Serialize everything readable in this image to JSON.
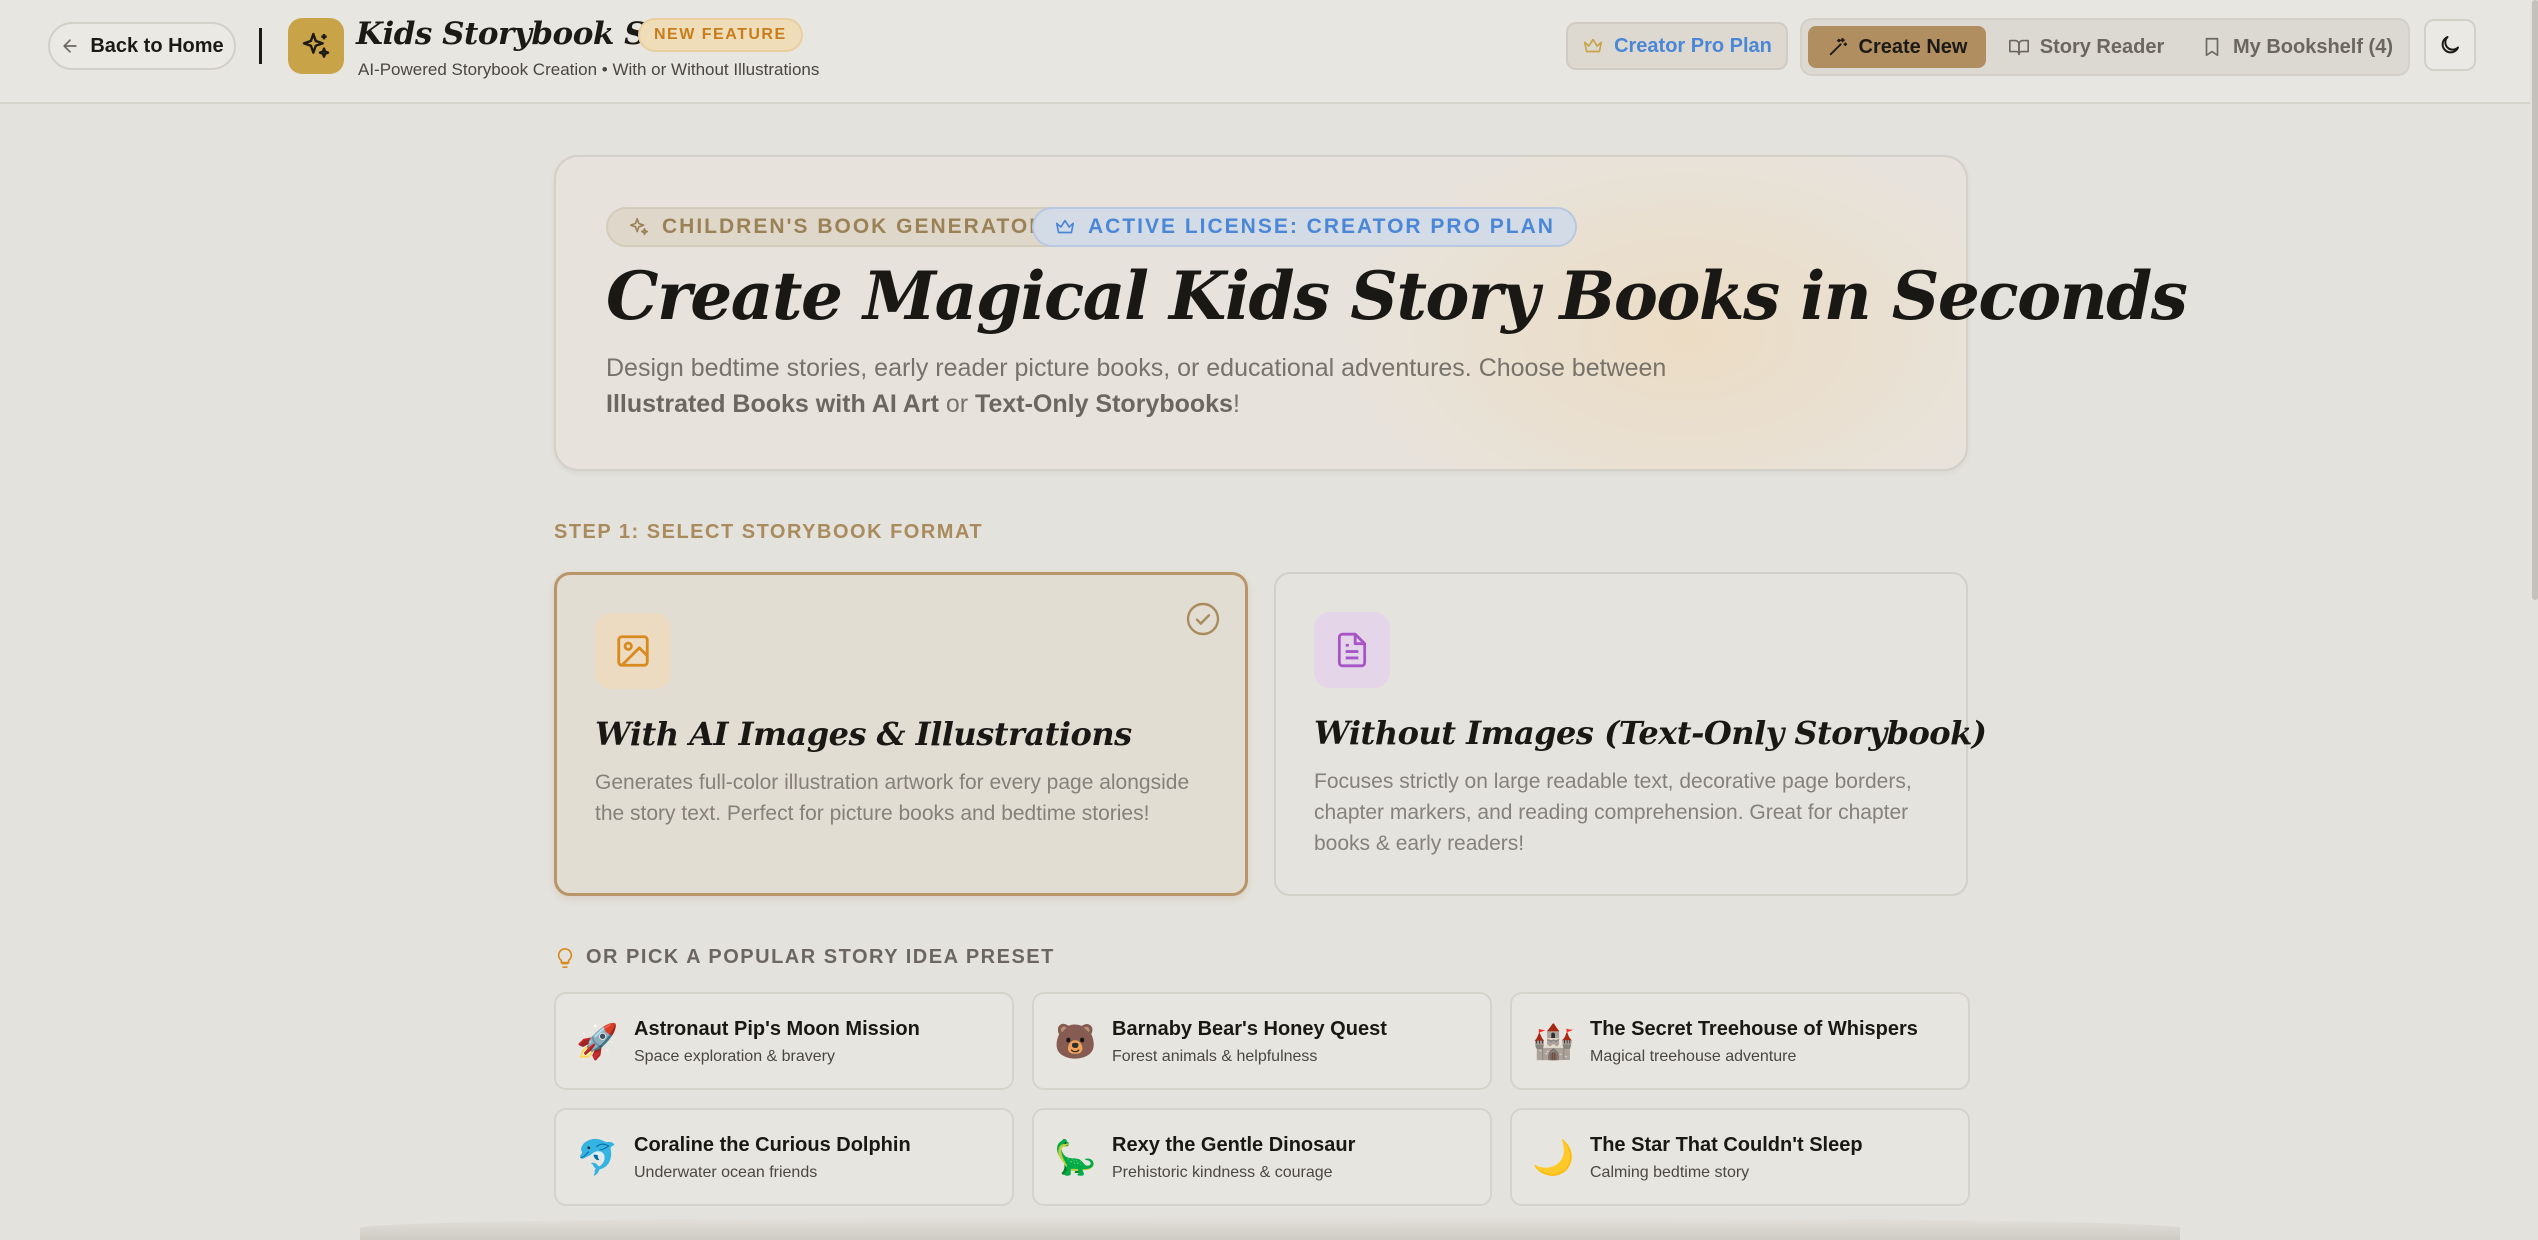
{
  "header": {
    "back_label": "Back to Home",
    "app_title": "Kids Storybook Studio",
    "new_badge": "NEW FEATURE",
    "subtitle": "AI-Powered Storybook Creation • With or Without Illustrations",
    "pro_plan_label": "Creator Pro Plan",
    "nav": [
      {
        "label": "Create New",
        "icon": "wand-icon",
        "active": true
      },
      {
        "label": "Story Reader",
        "icon": "book-open-icon",
        "active": false
      },
      {
        "label": "My Bookshelf (4)",
        "icon": "bookmark-icon",
        "active": false
      }
    ],
    "theme_icon": "moon-icon"
  },
  "hero": {
    "badge_generator": "CHILDREN'S BOOK GENERATOR",
    "badge_license": "ACTIVE LICENSE: CREATOR PRO PLAN",
    "title": "Create Magical Kids Story Books in Seconds",
    "desc_line1": "Design bedtime stories, early reader picture books, or educational adventures. Choose between",
    "desc_bold1": "Illustrated Books with AI Art",
    "desc_or": " or ",
    "desc_bold2": "Text-Only Storybooks",
    "desc_end": "!"
  },
  "step1": {
    "label": "STEP 1: SELECT STORYBOOK FORMAT",
    "options": [
      {
        "title": "With AI Images & Illustrations",
        "desc": "Generates full-color illustration artwork for every page alongside the story text. Perfect for picture books and bedtime stories!",
        "icon": "image-icon",
        "selected": true
      },
      {
        "title": "Without Images (Text-Only Storybook)",
        "desc": "Focuses strictly on large readable text, decorative page borders, chapter markers, and reading comprehension. Great for chapter books & early readers!",
        "icon": "document-icon",
        "selected": false
      }
    ]
  },
  "presets": {
    "label": "OR PICK A POPULAR STORY IDEA PRESET",
    "items": [
      {
        "emoji": "🚀",
        "title": "Astronaut Pip's Moon Mission",
        "subtitle": "Space exploration & bravery"
      },
      {
        "emoji": "🐻",
        "title": "Barnaby Bear's Honey Quest",
        "subtitle": "Forest animals & helpfulness"
      },
      {
        "emoji": "🏰",
        "title": "The Secret Treehouse of Whispers",
        "subtitle": "Magical treehouse adventure"
      },
      {
        "emoji": "🐬",
        "title": "Coraline the Curious Dolphin",
        "subtitle": "Underwater ocean friends"
      },
      {
        "emoji": "🦕",
        "title": "Rexy the Gentle Dinosaur",
        "subtitle": "Prehistoric kindness & courage"
      },
      {
        "emoji": "🌙",
        "title": "The Star That Couldn't Sleep",
        "subtitle": "Calming bedtime story"
      }
    ]
  },
  "colors": {
    "accent_gold": "#b18e5f",
    "accent_blue": "#4a87d6",
    "badge_orange": "#c87d1a"
  }
}
